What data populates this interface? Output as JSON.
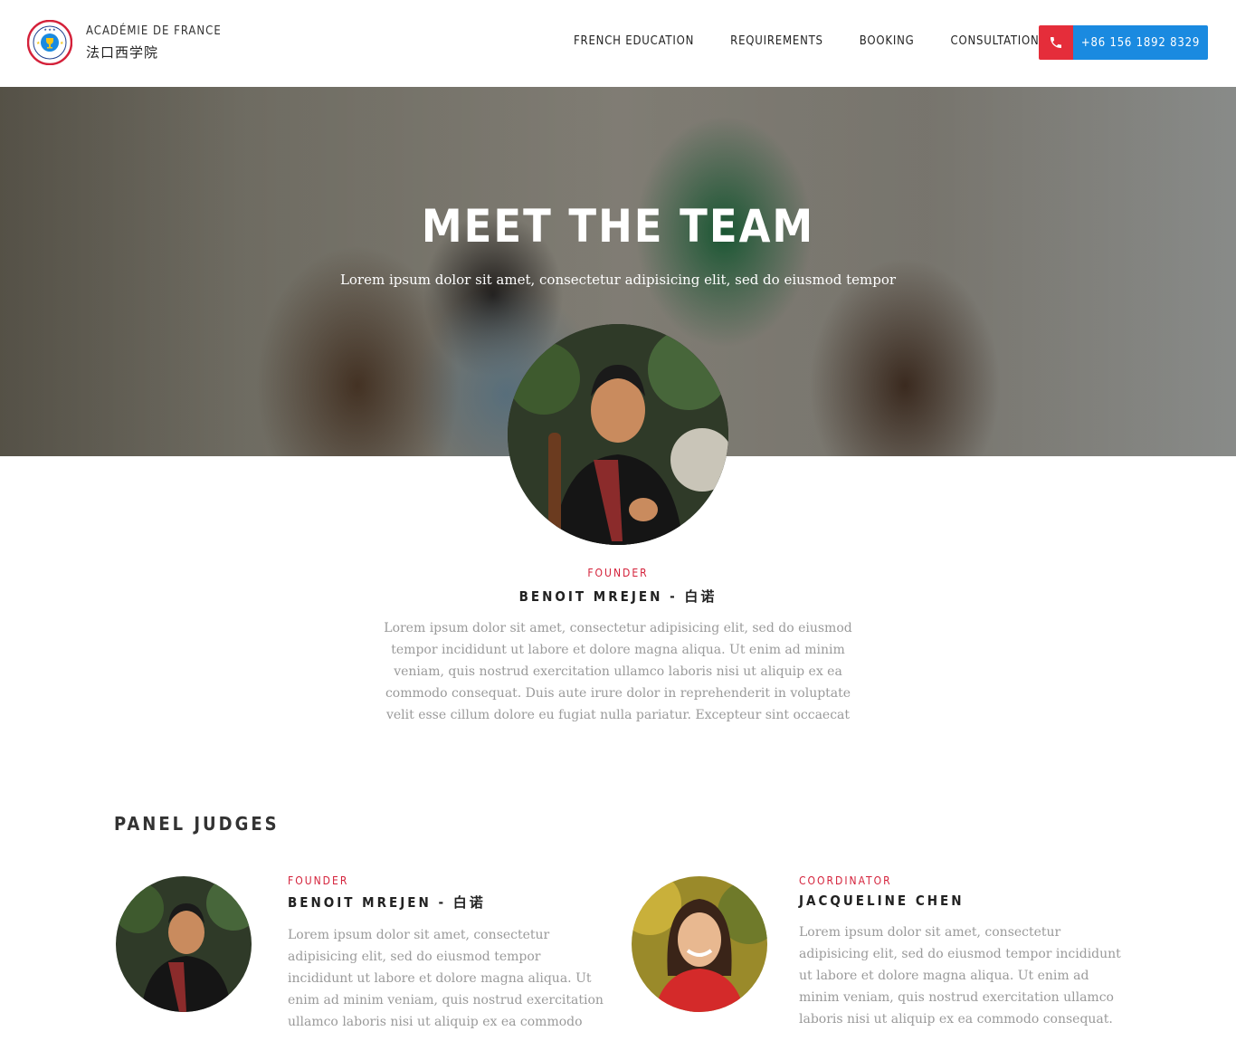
{
  "header": {
    "brand_en": "ACADÉMIE DE FRANCE",
    "brand_zh": "法口西学院",
    "nav": [
      {
        "label": "FRENCH EDUCATION"
      },
      {
        "label": "REQUIREMENTS"
      },
      {
        "label": "BOOKING"
      },
      {
        "label": "CONSULTATION"
      }
    ],
    "phone": "+86 156 1892 8329",
    "phone_icon": "phone-icon"
  },
  "hero": {
    "title": "MEET THE TEAM",
    "subtitle": "Lorem ipsum dolor sit amet, consectetur adipisicing elit, sed do eiusmod tempor"
  },
  "featured": {
    "role": "FOUNDER",
    "name": "BENOIT MREJEN - 白诺",
    "bio": "Lorem ipsum dolor sit amet, consectetur adipisicing elit, sed do eiusmod tempor incididunt ut labore et dolore magna aliqua. Ut enim ad minim veniam, quis nostrud exercitation ullamco laboris nisi ut aliquip ex ea commodo consequat. Duis aute irure dolor in reprehenderit in voluptate velit esse cillum dolore eu fugiat nulla pariatur. Excepteur sint occaecat"
  },
  "panel": {
    "title": "PANEL JUDGES",
    "judges": [
      {
        "role": "FOUNDER",
        "name": "BENOIT MREJEN - 白诺",
        "bio": "Lorem ipsum dolor sit amet, consectetur adipisicing elit, sed do eiusmod tempor incididunt ut labore et dolore magna aliqua. Ut enim ad minim veniam, quis nostrud exercitation ullamco laboris nisi ut aliquip ex ea commodo"
      },
      {
        "role": "COORDINATOR",
        "name": "JACQUELINE CHEN",
        "bio": "Lorem ipsum dolor sit amet, consectetur adipisicing elit, sed do eiusmod tempor incididunt ut labore et dolore magna aliqua. Ut enim ad minim veniam, quis nostrud exercitation ullamco laboris nisi ut aliquip ex ea commodo consequat."
      }
    ]
  },
  "colors": {
    "accent_red": "#d4213a",
    "phone_blue": "#1a8ae0",
    "phone_red": "#e52d3a"
  }
}
